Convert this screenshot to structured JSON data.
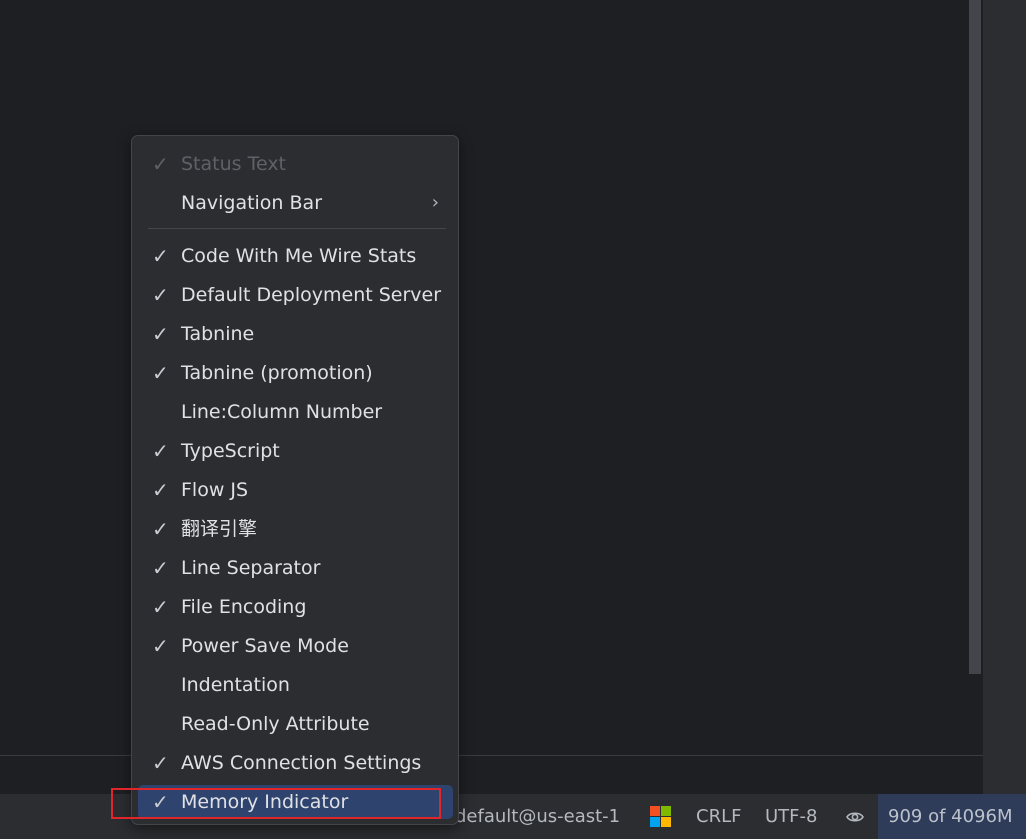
{
  "menu": {
    "items": [
      {
        "label": "Status Text",
        "checked": true,
        "disabled": true
      },
      {
        "label": "Navigation Bar",
        "checked": false,
        "submenu": true
      },
      {
        "label": "Code With Me Wire Stats",
        "checked": true
      },
      {
        "label": "Default Deployment Server",
        "checked": true
      },
      {
        "label": "Tabnine",
        "checked": true
      },
      {
        "label": "Tabnine (promotion)",
        "checked": true
      },
      {
        "label": "Line:Column Number",
        "checked": false
      },
      {
        "label": "TypeScript",
        "checked": true
      },
      {
        "label": "Flow JS",
        "checked": true
      },
      {
        "label": "翻译引擎",
        "checked": true
      },
      {
        "label": "Line Separator",
        "checked": true
      },
      {
        "label": "File Encoding",
        "checked": true
      },
      {
        "label": "Power Save Mode",
        "checked": true
      },
      {
        "label": "Indentation",
        "checked": false
      },
      {
        "label": "Read-Only Attribute",
        "checked": false
      },
      {
        "label": "AWS Connection Settings",
        "checked": true
      },
      {
        "label": "Memory Indicator",
        "checked": true,
        "selected": true
      }
    ],
    "check_glyph": "✓",
    "submenu_glyph": "›"
  },
  "status_bar": {
    "aws_profile": "default@us-east-1",
    "line_separator": "CRLF",
    "encoding": "UTF-8",
    "memory": "909 of 4096M",
    "icons": [
      "windows-logo-icon",
      "eye-icon"
    ]
  },
  "colors": {
    "selection": "#2e436e",
    "highlight_box": "#e0252b",
    "memory_bg": "#2e3b59"
  }
}
